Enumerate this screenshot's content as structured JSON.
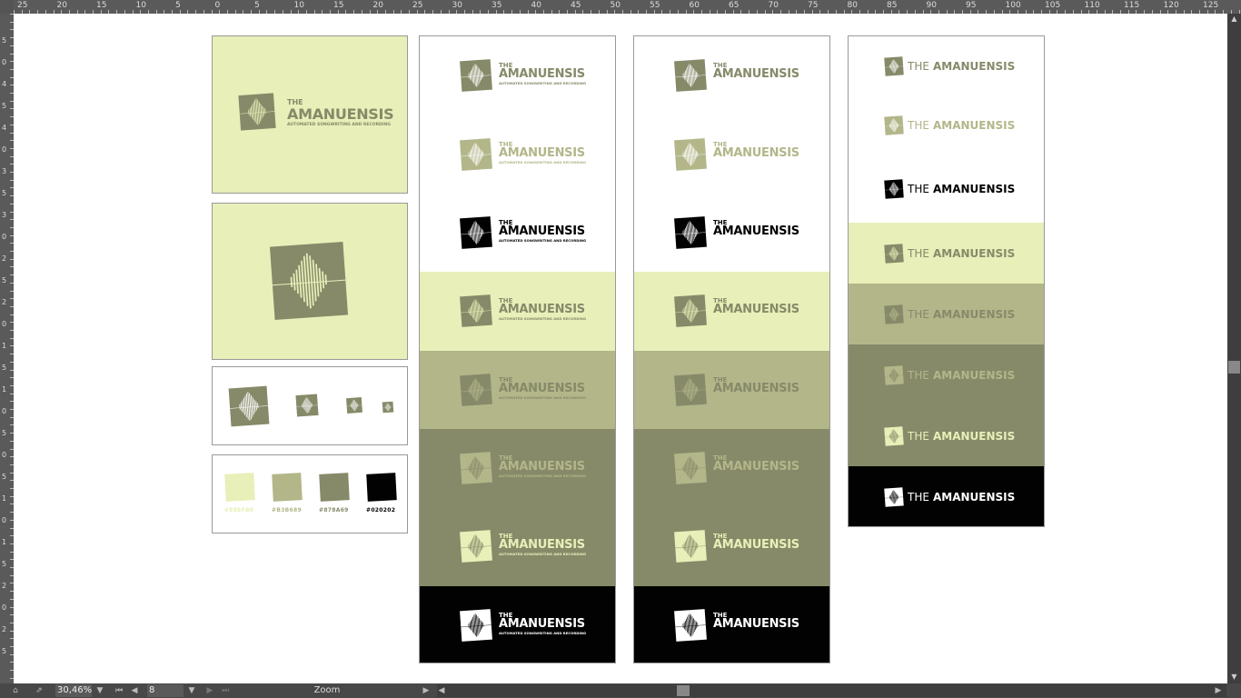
{
  "brand": {
    "the": "THE",
    "name": "AMANUENSIS",
    "tagline": "AUTOMATED SONGWRITING AND RECORDING",
    "inline_the": "THE",
    "inline_name": "AMANUENSIS"
  },
  "colors": {
    "cream": "#E8EFB8",
    "sage": "#B3B689",
    "olive": "#878A69",
    "black": "#020202",
    "white": "#FFFFFF"
  },
  "swatches": [
    {
      "hex": "#E8EFB8",
      "label": "#E8EFB8"
    },
    {
      "hex": "#B3B689",
      "label": "#B3B689"
    },
    {
      "hex": "#878A69",
      "label": "#878A69"
    },
    {
      "hex": "#020202",
      "label": "#020202"
    }
  ],
  "ruler": {
    "top_labels": [
      "25",
      "20",
      "15",
      "10",
      "5",
      "0",
      "5",
      "10",
      "15",
      "20",
      "25",
      "30",
      "35",
      "40",
      "45",
      "50",
      "55",
      "60",
      "65",
      "70",
      "75",
      "80",
      "85",
      "90",
      "95",
      "100",
      "105",
      "110",
      "115",
      "120",
      "125"
    ],
    "left_labels": [
      "5",
      "0",
      "4",
      "5",
      "4",
      "0",
      "3",
      "5",
      "3",
      "0",
      "2",
      "5",
      "2",
      "0",
      "1",
      "5",
      "1",
      "0",
      "5",
      "0",
      "5",
      "1",
      "0",
      "1",
      "5",
      "2",
      "0",
      "2",
      "5"
    ]
  },
  "status": {
    "zoom_value": "30,46%",
    "page_value": "8",
    "mode_label": "Zoom",
    "prev_icon": "◀",
    "next_icon": "▶",
    "first_icon": "⏮",
    "last_icon": "⏭",
    "dropdown_icon": "▼"
  }
}
